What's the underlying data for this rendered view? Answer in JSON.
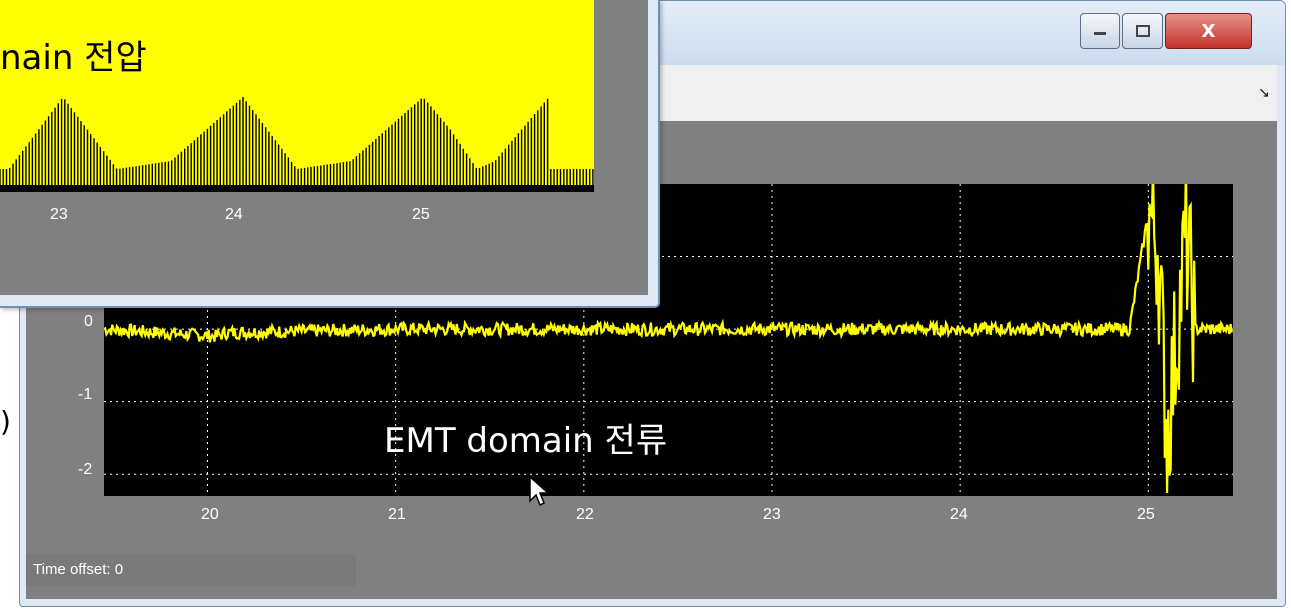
{
  "current_window": {
    "controls": {
      "minimize_icon": "minimize-icon",
      "maximize_icon": "maximize-icon",
      "close_label": "X"
    },
    "toolbar": {
      "dock_arrow": "↘"
    },
    "plot": {
      "overlay_label": "EMT domain 전류",
      "y_ticks": [
        "0",
        "-1",
        "-2"
      ],
      "x_ticks": [
        "20",
        "21",
        "22",
        "23",
        "24",
        "25"
      ],
      "trace_color": "#ffff00",
      "background_color": "#000000",
      "grid": "dotted"
    },
    "status": {
      "time_offset": "Time offset:  0"
    }
  },
  "voltage_window": {
    "plot": {
      "overlay_label": "nain 전압",
      "x_ticks": [
        "23",
        "24",
        "25"
      ],
      "background_color": "#ffff00",
      "trace_color": "#000000"
    }
  },
  "left_fragment": {
    "text": ")"
  },
  "chart_data": [
    {
      "type": "line",
      "title": "EMT domain 전류",
      "xlabel": "",
      "ylabel": "",
      "xlim": [
        19.45,
        25.45
      ],
      "ylim": [
        -2.3,
        2.0
      ],
      "x_ticks": [
        20,
        21,
        22,
        23,
        24,
        25
      ],
      "y_ticks": [
        0,
        -1,
        -2
      ],
      "grid": true,
      "series": [
        {
          "x": [
            19.45,
            20.05,
            20.1,
            21.0,
            22.0,
            23.0,
            24.0,
            24.9,
            25.0,
            25.05,
            25.1,
            25.2,
            25.25,
            25.45
          ],
          "y": [
            0.0,
            -0.1,
            -0.05,
            0.0,
            0.0,
            0.0,
            0.0,
            0.0,
            1.6,
            1.2,
            -1.5,
            1.3,
            0.0,
            0.0
          ]
        }
      ]
    },
    {
      "type": "area",
      "title": "nain 전압",
      "xlabel": "",
      "ylabel": "",
      "x_ticks": [
        23,
        24,
        25
      ],
      "grid": false,
      "series": [
        {
          "x": [
            22.7,
            23.0,
            23.3,
            23.6,
            24.0,
            24.3,
            24.6,
            25.0,
            25.15,
            25.3,
            25.4,
            25.7
          ],
          "y": [
            0.1,
            0.55,
            0.1,
            0.15,
            0.55,
            0.1,
            0.15,
            0.55,
            0.35,
            0.1,
            0.15,
            0.55
          ]
        }
      ]
    }
  ]
}
